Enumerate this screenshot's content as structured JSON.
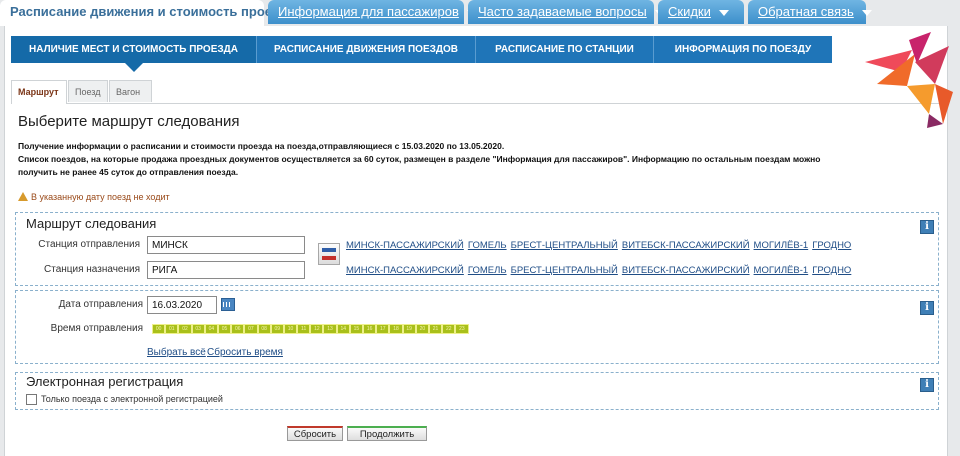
{
  "top_tabs": [
    {
      "label": "Расписание движения и стоимость проезда",
      "active": true
    },
    {
      "label": "Информация для пассажиров"
    },
    {
      "label": "Часто задаваемые вопросы"
    },
    {
      "label": "Скидки"
    },
    {
      "label": "Обратная связь"
    }
  ],
  "main_nav": [
    {
      "label": "НАЛИЧИЕ МЕСТ И СТОИМОСТЬ ПРОЕЗДА"
    },
    {
      "label": "РАСПИСАНИЕ ДВИЖЕНИЯ ПОЕЗДОВ"
    },
    {
      "label": "РАСПИСАНИЕ ПО СТАНЦИИ"
    },
    {
      "label": "ИНФОРМАЦИЯ ПО ПОЕЗДУ"
    }
  ],
  "sub_tabs": [
    {
      "label": "Маршрут"
    },
    {
      "label": "Поезд"
    },
    {
      "label": "Вагон"
    }
  ],
  "page_title": "Выберите маршрут следования",
  "info_text": {
    "line1": "Получение информации о расписании и стоимости проезда на поезда,отправляющиеся с 15.03.2020 по 13.05.2020.",
    "line2": "Список поездов, на которые продажа проездных документов осуществляется за 60 суток, размещен в разделе \"Информация для пассажиров\". Информацию по остальным поездам можно",
    "line3": "получить не ранее 45 суток до отправления поезда."
  },
  "warning": "В указанную дату поезд не ходит",
  "route": {
    "title": "Маршрут следования",
    "departure_label": "Станция отправления",
    "departure_value": "МИНСК",
    "arrival_label": "Станция назначения",
    "arrival_value": "РИГА",
    "stations_row1": [
      "МИНСК-ПАССАЖИРСКИЙ",
      "ГОМЕЛЬ",
      "БРЕСТ-ЦЕНТРАЛЬНЫЙ",
      "ВИТЕБСК-ПАССАЖИРСКИЙ",
      "МОГИЛЁВ-1",
      "ГРОДНО"
    ],
    "stations_row2": [
      "МИНСК-ПАССАЖИРСКИЙ",
      "ГОМЕЛЬ",
      "БРЕСТ-ЦЕНТРАЛЬНЫЙ",
      "ВИТЕБСК-ПАССАЖИРСКИЙ",
      "МОГИЛЁВ-1",
      "ГРОДНО"
    ]
  },
  "datetime": {
    "date_label": "Дата отправления",
    "date_value": "16.03.2020",
    "time_label": "Время отправления",
    "hours": [
      "00",
      "01",
      "02",
      "03",
      "04",
      "05",
      "06",
      "07",
      "08",
      "09",
      "10",
      "11",
      "12",
      "13",
      "14",
      "15",
      "16",
      "17",
      "18",
      "19",
      "20",
      "21",
      "22",
      "23"
    ],
    "select_all": "Выбрать всё",
    "reset_time": "Сбросить время"
  },
  "ereg": {
    "title": "Электронная регистрация",
    "checkbox_label": "Только поезда с электронной регистрацией"
  },
  "buttons": {
    "reset": "Сбросить",
    "continue": "Продолжить"
  },
  "info_icon_text": "i",
  "colors": {
    "nav_blue": "#1f75b8",
    "hour_green": "#a9c01a",
    "warning_brown": "#9a4a1a",
    "link_blue": "#1f4d86"
  }
}
